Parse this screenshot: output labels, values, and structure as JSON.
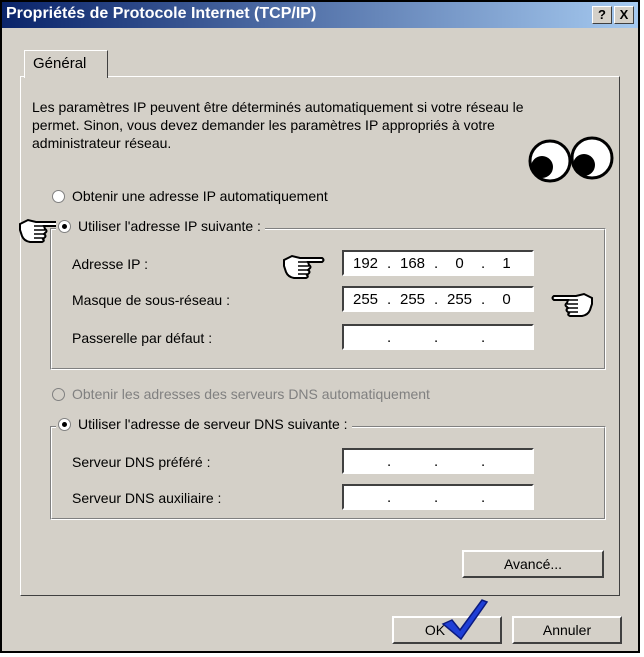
{
  "window": {
    "title": "Propriétés de Protocole Internet (TCP/IP)",
    "help_button": "?",
    "close_button": "X"
  },
  "tab": {
    "label": "Général"
  },
  "description": "Les paramètres IP peuvent être déterminés automatiquement si votre réseau le permet. Sinon, vous devez demander les paramètres IP appropriés à votre administrateur réseau.",
  "ip_options": {
    "auto_label": "Obtenir une adresse IP automatiquement",
    "manual_label": "Utiliser l'adresse IP suivante :",
    "selected": "manual"
  },
  "ip_fields": [
    {
      "label": "Adresse IP :",
      "octets": [
        "192",
        "168",
        "0",
        "1"
      ]
    },
    {
      "label": "Masque de sous-réseau :",
      "octets": [
        "255",
        "255",
        "255",
        "0"
      ]
    },
    {
      "label": "Passerelle par défaut :",
      "octets": [
        "",
        "",
        "",
        ""
      ]
    }
  ],
  "dns_options": {
    "auto_label": "Obtenir les adresses des serveurs DNS automatiquement",
    "auto_enabled": false,
    "manual_label": "Utiliser l'adresse de serveur DNS suivante :",
    "selected": "manual"
  },
  "dns_fields": [
    {
      "label": "Serveur DNS préféré :",
      "octets": [
        "",
        "",
        "",
        ""
      ]
    },
    {
      "label": "Serveur DNS auxiliaire :",
      "octets": [
        "",
        "",
        "",
        ""
      ]
    }
  ],
  "buttons": {
    "advanced": "Avancé...",
    "ok": "OK",
    "cancel": "Annuler"
  },
  "annotations": {
    "hand_icon": "pointing-hand-icon",
    "eyes_icon": "eyes-icon",
    "check_icon": "checkmark-icon",
    "check_color": "#1f3fd6"
  }
}
